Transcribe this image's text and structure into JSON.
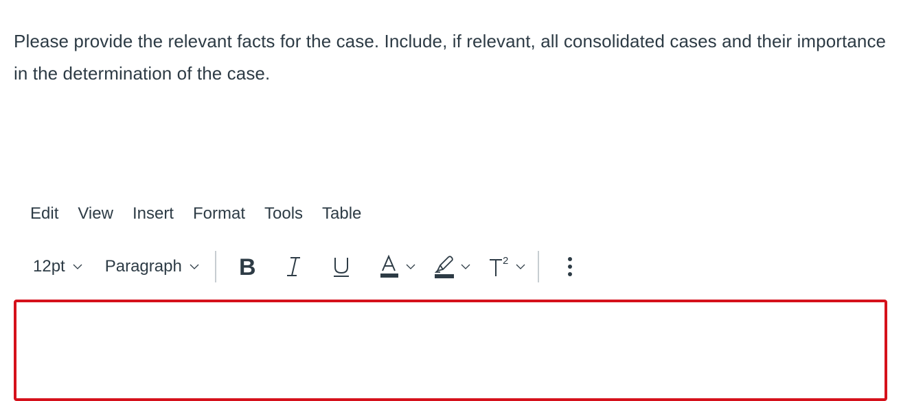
{
  "prompt": {
    "text": "Please provide the relevant facts for the case.  Include, if relevant, all consolidated cases and their importance in the determination of the case."
  },
  "menubar": {
    "items": [
      {
        "label": "Edit"
      },
      {
        "label": "View"
      },
      {
        "label": "Insert"
      },
      {
        "label": "Format"
      },
      {
        "label": "Tools"
      },
      {
        "label": "Table"
      }
    ]
  },
  "toolbar": {
    "font_size": "12pt",
    "block_format": "Paragraph",
    "buttons": {
      "bold": "bold-icon",
      "italic": "italic-icon",
      "underline": "underline-icon",
      "text_color": "text-color-icon",
      "highlight": "highlight-icon",
      "superscript": "superscript-icon",
      "more": "more-vertical-icon"
    }
  },
  "editor": {
    "content": "",
    "border_color": "#d5111b"
  },
  "colors": {
    "text": "#2d3b45",
    "separator": "#c7cdd1",
    "error_border": "#d5111b"
  }
}
